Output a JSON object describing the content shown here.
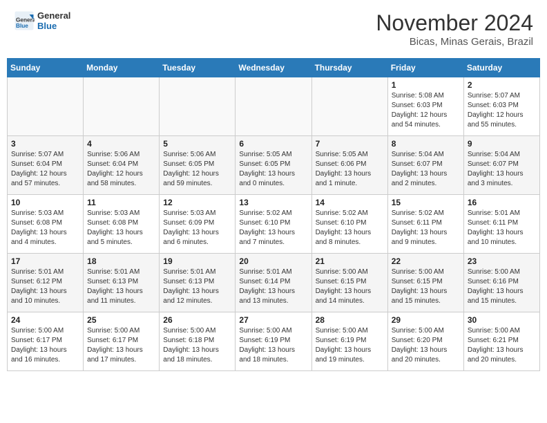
{
  "header": {
    "logo_general": "General",
    "logo_blue": "Blue",
    "month_title": "November 2024",
    "location": "Bicas, Minas Gerais, Brazil"
  },
  "weekdays": [
    "Sunday",
    "Monday",
    "Tuesday",
    "Wednesday",
    "Thursday",
    "Friday",
    "Saturday"
  ],
  "weeks": [
    [
      {
        "day": "",
        "info": ""
      },
      {
        "day": "",
        "info": ""
      },
      {
        "day": "",
        "info": ""
      },
      {
        "day": "",
        "info": ""
      },
      {
        "day": "",
        "info": ""
      },
      {
        "day": "1",
        "info": "Sunrise: 5:08 AM\nSunset: 6:03 PM\nDaylight: 12 hours\nand 54 minutes."
      },
      {
        "day": "2",
        "info": "Sunrise: 5:07 AM\nSunset: 6:03 PM\nDaylight: 12 hours\nand 55 minutes."
      }
    ],
    [
      {
        "day": "3",
        "info": "Sunrise: 5:07 AM\nSunset: 6:04 PM\nDaylight: 12 hours\nand 57 minutes."
      },
      {
        "day": "4",
        "info": "Sunrise: 5:06 AM\nSunset: 6:04 PM\nDaylight: 12 hours\nand 58 minutes."
      },
      {
        "day": "5",
        "info": "Sunrise: 5:06 AM\nSunset: 6:05 PM\nDaylight: 12 hours\nand 59 minutes."
      },
      {
        "day": "6",
        "info": "Sunrise: 5:05 AM\nSunset: 6:05 PM\nDaylight: 13 hours\nand 0 minutes."
      },
      {
        "day": "7",
        "info": "Sunrise: 5:05 AM\nSunset: 6:06 PM\nDaylight: 13 hours\nand 1 minute."
      },
      {
        "day": "8",
        "info": "Sunrise: 5:04 AM\nSunset: 6:07 PM\nDaylight: 13 hours\nand 2 minutes."
      },
      {
        "day": "9",
        "info": "Sunrise: 5:04 AM\nSunset: 6:07 PM\nDaylight: 13 hours\nand 3 minutes."
      }
    ],
    [
      {
        "day": "10",
        "info": "Sunrise: 5:03 AM\nSunset: 6:08 PM\nDaylight: 13 hours\nand 4 minutes."
      },
      {
        "day": "11",
        "info": "Sunrise: 5:03 AM\nSunset: 6:08 PM\nDaylight: 13 hours\nand 5 minutes."
      },
      {
        "day": "12",
        "info": "Sunrise: 5:03 AM\nSunset: 6:09 PM\nDaylight: 13 hours\nand 6 minutes."
      },
      {
        "day": "13",
        "info": "Sunrise: 5:02 AM\nSunset: 6:10 PM\nDaylight: 13 hours\nand 7 minutes."
      },
      {
        "day": "14",
        "info": "Sunrise: 5:02 AM\nSunset: 6:10 PM\nDaylight: 13 hours\nand 8 minutes."
      },
      {
        "day": "15",
        "info": "Sunrise: 5:02 AM\nSunset: 6:11 PM\nDaylight: 13 hours\nand 9 minutes."
      },
      {
        "day": "16",
        "info": "Sunrise: 5:01 AM\nSunset: 6:11 PM\nDaylight: 13 hours\nand 10 minutes."
      }
    ],
    [
      {
        "day": "17",
        "info": "Sunrise: 5:01 AM\nSunset: 6:12 PM\nDaylight: 13 hours\nand 10 minutes."
      },
      {
        "day": "18",
        "info": "Sunrise: 5:01 AM\nSunset: 6:13 PM\nDaylight: 13 hours\nand 11 minutes."
      },
      {
        "day": "19",
        "info": "Sunrise: 5:01 AM\nSunset: 6:13 PM\nDaylight: 13 hours\nand 12 minutes."
      },
      {
        "day": "20",
        "info": "Sunrise: 5:01 AM\nSunset: 6:14 PM\nDaylight: 13 hours\nand 13 minutes."
      },
      {
        "day": "21",
        "info": "Sunrise: 5:00 AM\nSunset: 6:15 PM\nDaylight: 13 hours\nand 14 minutes."
      },
      {
        "day": "22",
        "info": "Sunrise: 5:00 AM\nSunset: 6:15 PM\nDaylight: 13 hours\nand 15 minutes."
      },
      {
        "day": "23",
        "info": "Sunrise: 5:00 AM\nSunset: 6:16 PM\nDaylight: 13 hours\nand 15 minutes."
      }
    ],
    [
      {
        "day": "24",
        "info": "Sunrise: 5:00 AM\nSunset: 6:17 PM\nDaylight: 13 hours\nand 16 minutes."
      },
      {
        "day": "25",
        "info": "Sunrise: 5:00 AM\nSunset: 6:17 PM\nDaylight: 13 hours\nand 17 minutes."
      },
      {
        "day": "26",
        "info": "Sunrise: 5:00 AM\nSunset: 6:18 PM\nDaylight: 13 hours\nand 18 minutes."
      },
      {
        "day": "27",
        "info": "Sunrise: 5:00 AM\nSunset: 6:19 PM\nDaylight: 13 hours\nand 18 minutes."
      },
      {
        "day": "28",
        "info": "Sunrise: 5:00 AM\nSunset: 6:19 PM\nDaylight: 13 hours\nand 19 minutes."
      },
      {
        "day": "29",
        "info": "Sunrise: 5:00 AM\nSunset: 6:20 PM\nDaylight: 13 hours\nand 20 minutes."
      },
      {
        "day": "30",
        "info": "Sunrise: 5:00 AM\nSunset: 6:21 PM\nDaylight: 13 hours\nand 20 minutes."
      }
    ]
  ]
}
